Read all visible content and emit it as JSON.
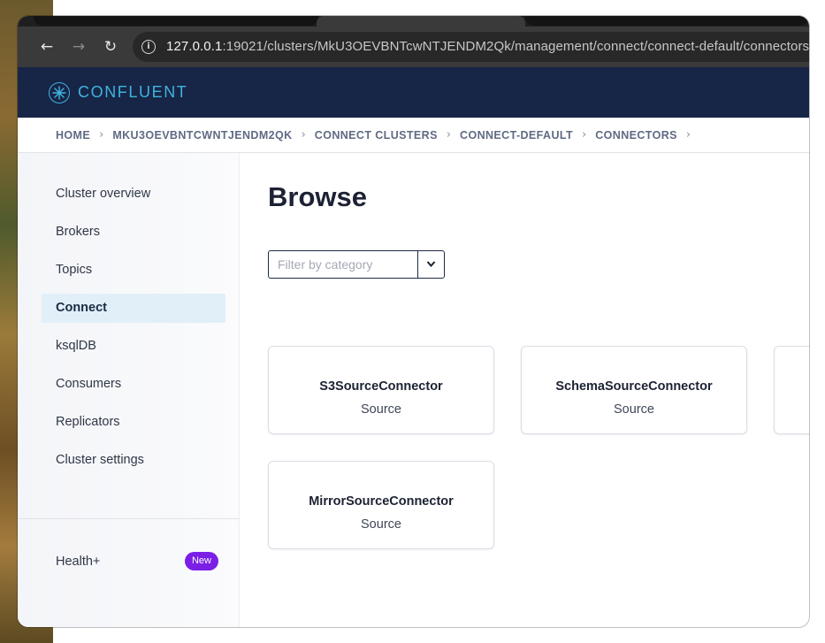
{
  "browser": {
    "url_host": "127.0.0.1",
    "url_rest": ":19021/clusters/MkU3OEVBNTcwNTJENDM2Qk/management/connect/connect-default/connectors/bro"
  },
  "app": {
    "brand": "CONFLUENT"
  },
  "breadcrumb": [
    "HOME",
    "MKU3OEVBNTCWNTJENDM2QK",
    "CONNECT CLUSTERS",
    "CONNECT-DEFAULT",
    "CONNECTORS"
  ],
  "sidebar": {
    "items": [
      {
        "label": "Cluster overview"
      },
      {
        "label": "Brokers"
      },
      {
        "label": "Topics"
      },
      {
        "label": "Connect"
      },
      {
        "label": "ksqlDB"
      },
      {
        "label": "Consumers"
      },
      {
        "label": "Replicators"
      },
      {
        "label": "Cluster settings"
      }
    ],
    "active": "Connect",
    "health_label": "Health+",
    "health_badge": "New"
  },
  "main": {
    "title": "Browse",
    "filter": {
      "placeholder": "Filter by category",
      "value": ""
    },
    "cards": [
      {
        "name": "S3SourceConnector",
        "type": "Source"
      },
      {
        "name": "SchemaSourceConnector",
        "type": "Source"
      },
      {
        "name": "",
        "type": ""
      },
      {
        "name": "MirrorSourceConnector",
        "type": "Source"
      }
    ]
  },
  "colors": {
    "header_bg": "#172546",
    "brand_accent": "#3fb4e0",
    "active_nav_bg": "#e1f0f8",
    "badge_purple": "#7b1fe6"
  },
  "icons": {
    "back": "arrow-left-icon",
    "forward": "arrow-right-icon",
    "reload": "reload-icon",
    "site_info": "info-icon",
    "logo": "confluent-logo-icon",
    "breadcrumb_separator": "chevron-right-icon",
    "dropdown": "chevron-down-icon"
  }
}
